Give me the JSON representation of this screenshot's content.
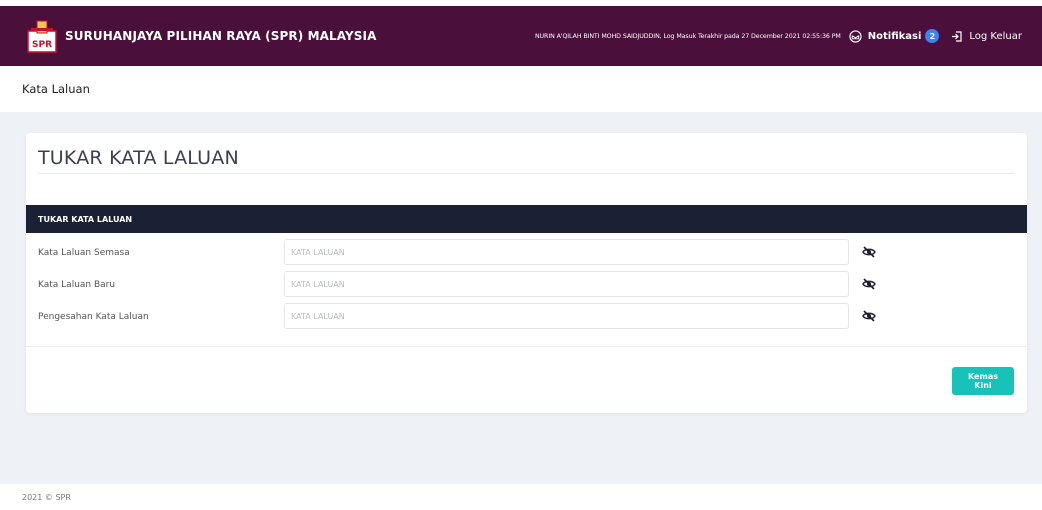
{
  "header": {
    "brand": "SURUHANJAYA PILIHAN RAYA (SPR) MALAYSIA",
    "logo_text": "SPR",
    "user_info": "NURIN A'QILAH BINTI MOHD SAIDJUDDIN, Log Masuk Terakhir pada 27 December 2021 02:55:36 PM",
    "notif_label": "Notifikasi",
    "notif_count": "2",
    "logout_label": "Log Keluar"
  },
  "breadcrumb": "Kata Laluan",
  "card": {
    "title": "TUKAR KATA LALUAN",
    "section_title": "TUKAR KATA LALUAN",
    "fields": [
      {
        "label": "Kata Laluan Semasa",
        "placeholder": "KATA LALUAN"
      },
      {
        "label": "Kata Laluan Baru",
        "placeholder": "KATA LALUAN"
      },
      {
        "label": "Pengesahan Kata Laluan",
        "placeholder": "KATA LALUAN"
      }
    ],
    "submit_label": "Kemas Kini"
  },
  "footer": "2021 © SPR",
  "colors": {
    "topbar": "#4a0f3b",
    "section_head": "#1c2035",
    "button": "#17c3b8",
    "badge": "#3b82f6"
  }
}
